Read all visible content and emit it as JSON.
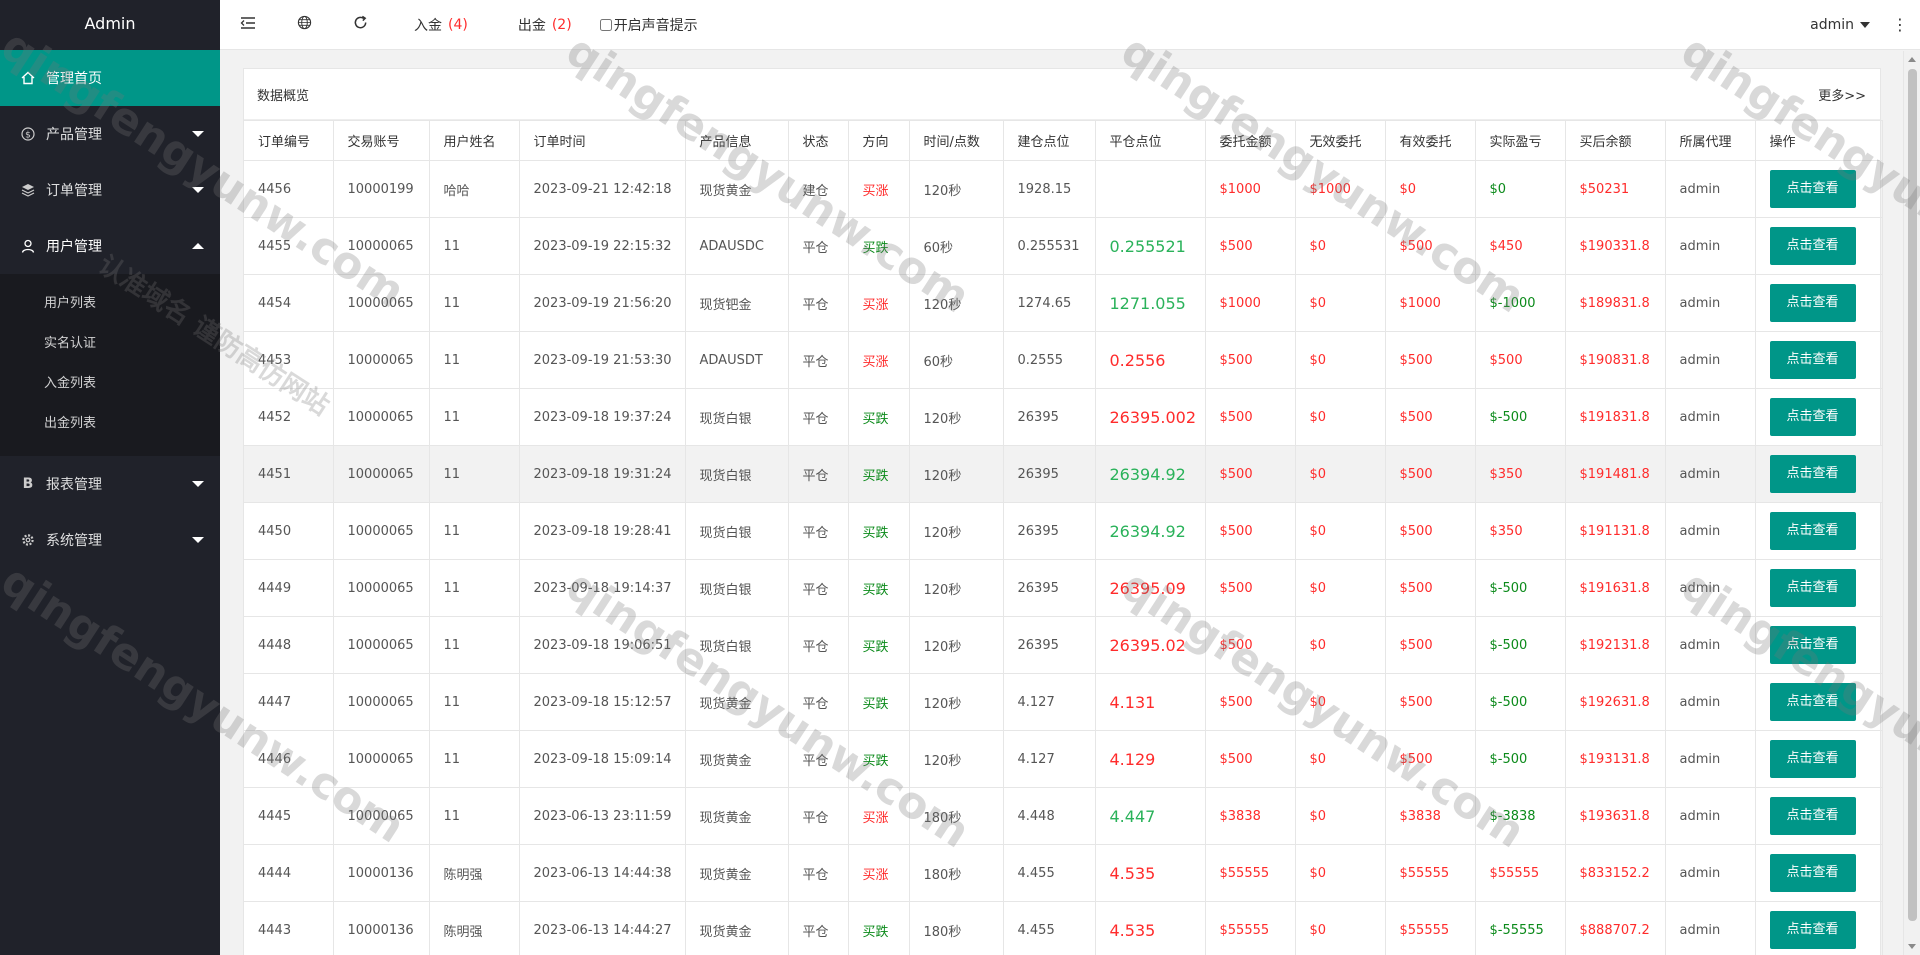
{
  "app": {
    "title": "Admin"
  },
  "sidebar": {
    "items": [
      {
        "label": "管理首页",
        "icon": "home-icon"
      },
      {
        "label": "产品管理",
        "icon": "dollar-icon"
      },
      {
        "label": "订单管理",
        "icon": "layers-icon"
      },
      {
        "label": "用户管理",
        "icon": "user-icon"
      },
      {
        "label": "报表管理",
        "icon": "bold-b-icon"
      },
      {
        "label": "系统管理",
        "icon": "gear-icon"
      }
    ],
    "user_sub": [
      "用户列表",
      "实名认证",
      "入金列表",
      "出金列表"
    ]
  },
  "header": {
    "deposit_label": "入金",
    "deposit_count": "(4)",
    "withdraw_label": "出金",
    "withdraw_count": "(2)",
    "sound_label": "开启声音提示",
    "user": "admin",
    "more": "⋮"
  },
  "panel": {
    "title": "数据概览",
    "more": "更多>>"
  },
  "table": {
    "columns": [
      "订单编号",
      "交易账号",
      "用户姓名",
      "订单时间",
      "产品信息",
      "状态",
      "方向",
      "时间/点数",
      "建仓点位",
      "平仓点位",
      "委托金额",
      "无效委托",
      "有效委托",
      "实际盈亏",
      "买后余额",
      "所属代理",
      "操作"
    ],
    "action_label": "点击查看",
    "rows": [
      [
        "4456",
        "10000199",
        "哈哈",
        "2023-09-21 12:42:18",
        "现货黄金",
        "建仓",
        "买涨",
        "120秒",
        "1928.15",
        "",
        "$1000",
        "$1000",
        "$0",
        "$0",
        "$50231",
        "admin"
      ],
      [
        "4455",
        "10000065",
        "11",
        "2023-09-19 22:15:32",
        "ADAUSDC",
        "平仓",
        "买跌",
        "60秒",
        "0.255531",
        "0.255521",
        "$500",
        "$0",
        "$500",
        "$450",
        "$190331.8",
        "admin"
      ],
      [
        "4454",
        "10000065",
        "11",
        "2023-09-19 21:56:20",
        "现货钯金",
        "平仓",
        "买涨",
        "120秒",
        "1274.65",
        "1271.055",
        "$1000",
        "$0",
        "$1000",
        "$-1000",
        "$189831.8",
        "admin"
      ],
      [
        "4453",
        "10000065",
        "11",
        "2023-09-19 21:53:30",
        "ADAUSDT",
        "平仓",
        "买涨",
        "60秒",
        "0.2555",
        "0.2556",
        "$500",
        "$0",
        "$500",
        "$500",
        "$190831.8",
        "admin"
      ],
      [
        "4452",
        "10000065",
        "11",
        "2023-09-18 19:37:24",
        "现货白银",
        "平仓",
        "买跌",
        "120秒",
        "26395",
        "26395.002",
        "$500",
        "$0",
        "$500",
        "$-500",
        "$191831.8",
        "admin"
      ],
      [
        "4451",
        "10000065",
        "11",
        "2023-09-18 19:31:24",
        "现货白银",
        "平仓",
        "买跌",
        "120秒",
        "26395",
        "26394.92",
        "$500",
        "$0",
        "$500",
        "$350",
        "$191481.8",
        "admin"
      ],
      [
        "4450",
        "10000065",
        "11",
        "2023-09-18 19:28:41",
        "现货白银",
        "平仓",
        "买跌",
        "120秒",
        "26395",
        "26394.92",
        "$500",
        "$0",
        "$500",
        "$350",
        "$191131.8",
        "admin"
      ],
      [
        "4449",
        "10000065",
        "11",
        "2023-09-18 19:14:37",
        "现货白银",
        "平仓",
        "买跌",
        "120秒",
        "26395",
        "26395.09",
        "$500",
        "$0",
        "$500",
        "$-500",
        "$191631.8",
        "admin"
      ],
      [
        "4448",
        "10000065",
        "11",
        "2023-09-18 19:06:51",
        "现货白银",
        "平仓",
        "买跌",
        "120秒",
        "26395",
        "26395.02",
        "$500",
        "$0",
        "$500",
        "$-500",
        "$192131.8",
        "admin"
      ],
      [
        "4447",
        "10000065",
        "11",
        "2023-09-18 15:12:57",
        "现货黄金",
        "平仓",
        "买跌",
        "120秒",
        "4.127",
        "4.131",
        "$500",
        "$0",
        "$500",
        "$-500",
        "$192631.8",
        "admin"
      ],
      [
        "4446",
        "10000065",
        "11",
        "2023-09-18 15:09:14",
        "现货黄金",
        "平仓",
        "买跌",
        "120秒",
        "4.127",
        "4.129",
        "$500",
        "$0",
        "$500",
        "$-500",
        "$193131.8",
        "admin"
      ],
      [
        "4445",
        "10000065",
        "11",
        "2023-06-13 23:11:59",
        "现货黄金",
        "平仓",
        "买涨",
        "180秒",
        "4.448",
        "4.447",
        "$3838",
        "$0",
        "$3838",
        "$-3838",
        "$193631.8",
        "admin"
      ],
      [
        "4444",
        "10000136",
        "陈明强",
        "2023-06-13 14:44:38",
        "现货黄金",
        "平仓",
        "买涨",
        "180秒",
        "4.455",
        "4.535",
        "$55555",
        "$0",
        "$55555",
        "$55555",
        "$833152.2",
        "admin"
      ],
      [
        "4443",
        "10000136",
        "陈明强",
        "2023-06-13 14:44:27",
        "现货黄金",
        "平仓",
        "买跌",
        "180秒",
        "4.455",
        "4.535",
        "$55555",
        "$0",
        "$55555",
        "$-55555",
        "$888707.2",
        "admin"
      ]
    ]
  },
  "watermarks": {
    "domain": "qingfengyunw.com",
    "slogan": "认准域名 谨防高仿网站"
  },
  "colors": {
    "accent": "#009688",
    "sidebar": "#20222a",
    "red": "#ff2b2b",
    "green": "#0b8a1a"
  }
}
